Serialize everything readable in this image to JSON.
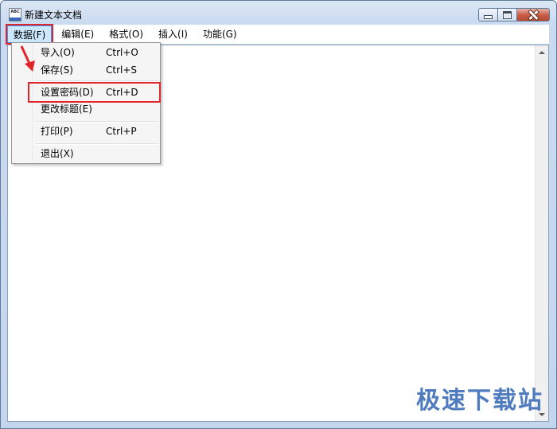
{
  "window": {
    "title": "新建文本文档"
  },
  "titlebar_buttons": [
    "minimize",
    "maximize",
    "close"
  ],
  "menubar": {
    "items": [
      {
        "label": "数据(F)",
        "active": true
      },
      {
        "label": "编辑(E)"
      },
      {
        "label": "格式(O)"
      },
      {
        "label": "插入(I)"
      },
      {
        "label": "功能(G)"
      }
    ]
  },
  "dropdown": {
    "items": [
      {
        "label": "导入(O)",
        "shortcut": "Ctrl+O"
      },
      {
        "label": "保存(S)",
        "shortcut": "Ctrl+S"
      },
      {
        "label": "设置密码(D)",
        "shortcut": "Ctrl+D",
        "highlighted": true
      },
      {
        "label": "更改标题(E)",
        "shortcut": ""
      },
      {
        "label": "打印(P)",
        "shortcut": "Ctrl+P"
      },
      {
        "label": "退出(X)",
        "shortcut": ""
      }
    ]
  },
  "watermark": "极速下载站",
  "colors": {
    "highlight_box": "#e0262a",
    "menu_active_bg": "#cce8ff",
    "watermark": "#3c6eb8"
  }
}
